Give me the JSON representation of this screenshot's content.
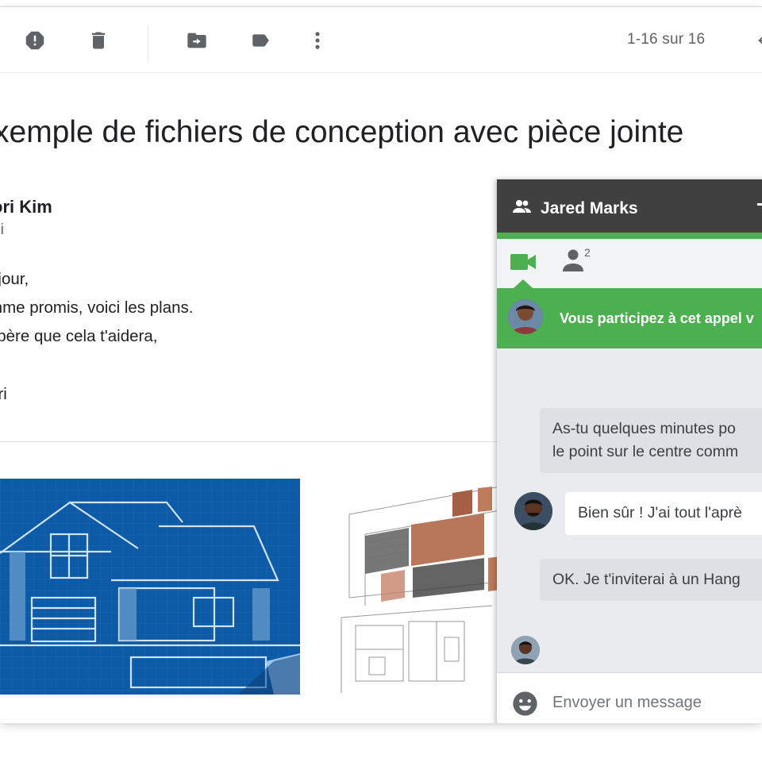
{
  "toolbar": {
    "icons": [
      "report-spam-icon",
      "delete-icon",
      "move-to-icon",
      "label-icon",
      "more-vert-icon",
      "back-arrow-icon"
    ],
    "pager_text": "1-16 sur 16"
  },
  "email": {
    "subject": "xemple de fichiers de conception avec pièce jointe",
    "sender_name": "ori Kim",
    "recipient": "oi",
    "body_lines": [
      "njour,",
      "mme promis, voici les plans.",
      "spère que cela t'aidera,",
      "ori"
    ]
  },
  "attachments": [
    {
      "name": "blueprint-house-image"
    },
    {
      "name": "architecture-sketch-image"
    }
  ],
  "chat": {
    "title": "Jared Marks",
    "participants_count": "2",
    "call_banner": "Vous participez à cet appel v",
    "messages": [
      {
        "direction": "out",
        "lines": [
          "As-tu quelques minutes po",
          "le point sur le centre comm"
        ]
      },
      {
        "direction": "in",
        "lines": [
          "Bien sûr ! J'ai tout l'aprè"
        ]
      },
      {
        "direction": "out",
        "lines": [
          "OK. Je t'inviterai à un Hang"
        ]
      }
    ],
    "composer_placeholder": "Envoyer un message"
  },
  "colors": {
    "chat_header": "#404040",
    "accent_green": "#4caf50",
    "blueprint_blue": "#0d5aa7"
  }
}
